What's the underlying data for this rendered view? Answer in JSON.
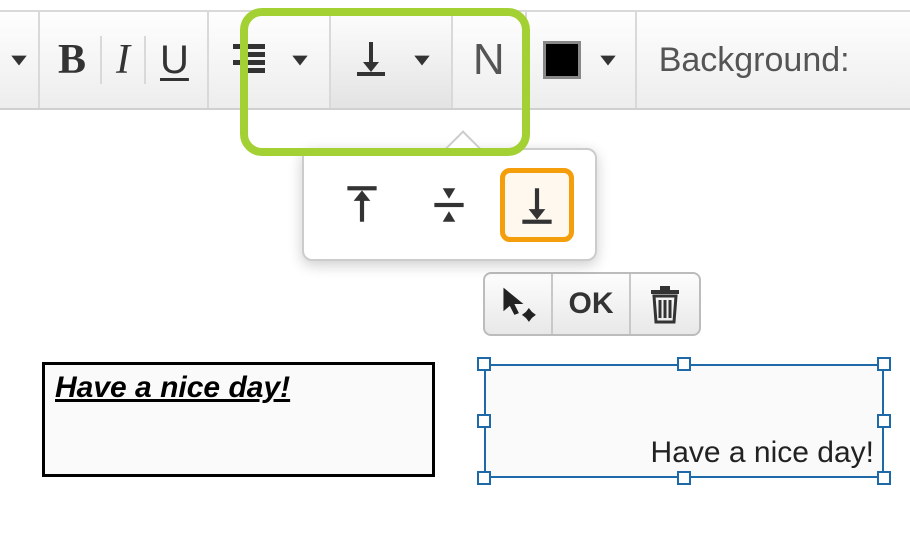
{
  "toolbar": {
    "bold_letter": "B",
    "italic_letter": "I",
    "underline_letter": "U",
    "n_button": "N",
    "fill_color": "#000000",
    "background_label": "Background:"
  },
  "vertical_align_popup": {
    "options": [
      "top",
      "middle",
      "bottom"
    ],
    "selected": "bottom"
  },
  "mini_toolbar": {
    "ok_label": "OK"
  },
  "textbox_left": {
    "text": "Have a nice day!"
  },
  "textbox_right": {
    "text": "Have a nice day!"
  }
}
